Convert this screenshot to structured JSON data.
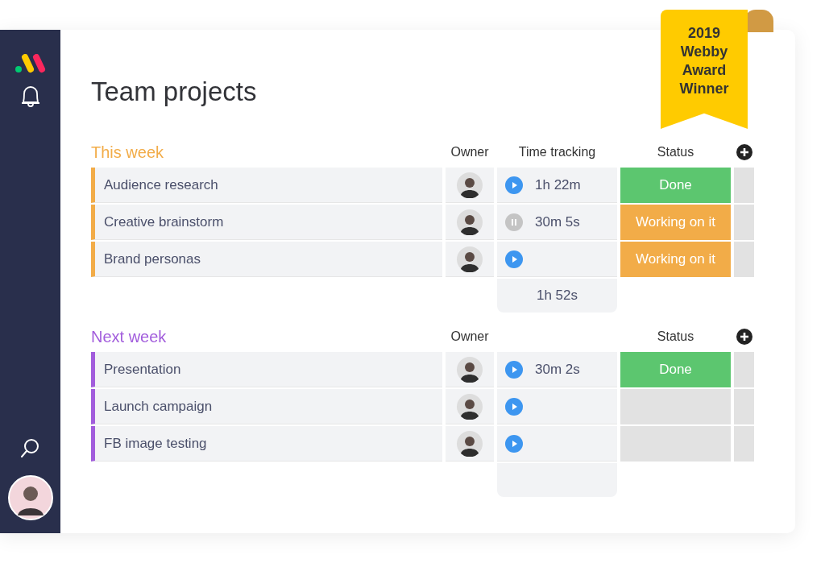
{
  "page": {
    "title": "Team projects"
  },
  "badge": {
    "lines": [
      "2019",
      "Webby",
      "Award",
      "Winner"
    ]
  },
  "groups": [
    {
      "title": "This week",
      "color": "#f2ac48",
      "columns": {
        "owner": "Owner",
        "time": "Time tracking",
        "status": "Status"
      },
      "rows": [
        {
          "name": "Audience research",
          "running": false,
          "time": "1h 22m",
          "status": {
            "label": "Done",
            "color": "#5cc66f"
          }
        },
        {
          "name": "Creative brainstorm",
          "running": true,
          "time": "30m 5s",
          "status": {
            "label": "Working on it",
            "color": "#f2ac48"
          }
        },
        {
          "name": "Brand personas",
          "running": false,
          "status": {
            "label": "Working on it",
            "color": "#f2ac48"
          }
        }
      ],
      "total": "1h 52s"
    },
    {
      "title": "Next week",
      "color": "#a25ddc",
      "columns": {
        "owner": "Owner",
        "status": "Status"
      },
      "rows": [
        {
          "name": "Presentation",
          "running": false,
          "time": "30m 2s",
          "status": {
            "label": "Done",
            "color": "#5cc66f"
          }
        },
        {
          "name": "Launch campaign",
          "running": false,
          "status": {
            "color": "#e2e2e2"
          }
        },
        {
          "name": "FB image testing",
          "running": false,
          "status": {
            "color": "#e2e2e2"
          }
        }
      ]
    }
  ]
}
